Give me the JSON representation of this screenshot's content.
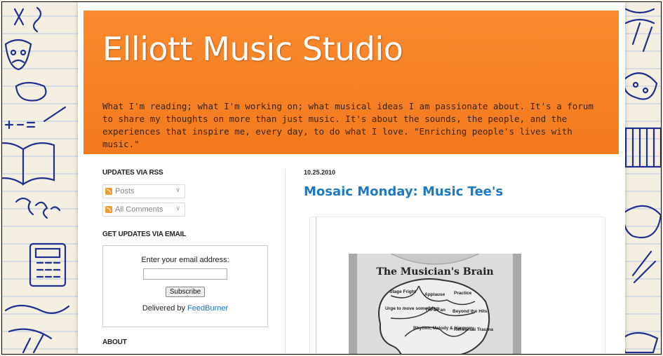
{
  "blog": {
    "title": "Elliott Music Studio",
    "description": "What I'm reading; what I'm working on; what musical ideas I am passionate about. It's a forum to share my thoughts on more than just music. It's about the sounds, the people, and the experiences that inspire me, every day, to do what I love. \"Enriching people's lives with music.\""
  },
  "sidebar": {
    "rss_title": "UPDATES VIA RSS",
    "rss_posts": "Posts",
    "rss_comments": "All Comments",
    "email_title": "GET UPDATES VIA EMAIL",
    "email_label": "Enter your email address:",
    "email_value": "",
    "subscribe_label": "Subscribe",
    "delivered_by": "Delivered by",
    "feedburner": "FeedBurner",
    "about_title": "ABOUT"
  },
  "post": {
    "date": "10.25.2010",
    "title": "Mosaic Monday: Music Tee's",
    "image_title": "The Musician's Brain",
    "brain_labels": [
      "Stage Fright",
      "Applause",
      "Practice",
      "Urge to move something",
      "I'm a Fan",
      "Beyond the Hits",
      "Rhythm, Melody & Harmony",
      "Rehearsal Trauma"
    ]
  },
  "colors": {
    "header_orange": "#f37a1d",
    "link_blue": "#1e79c4",
    "doodle_blue": "#1e2f8f"
  }
}
